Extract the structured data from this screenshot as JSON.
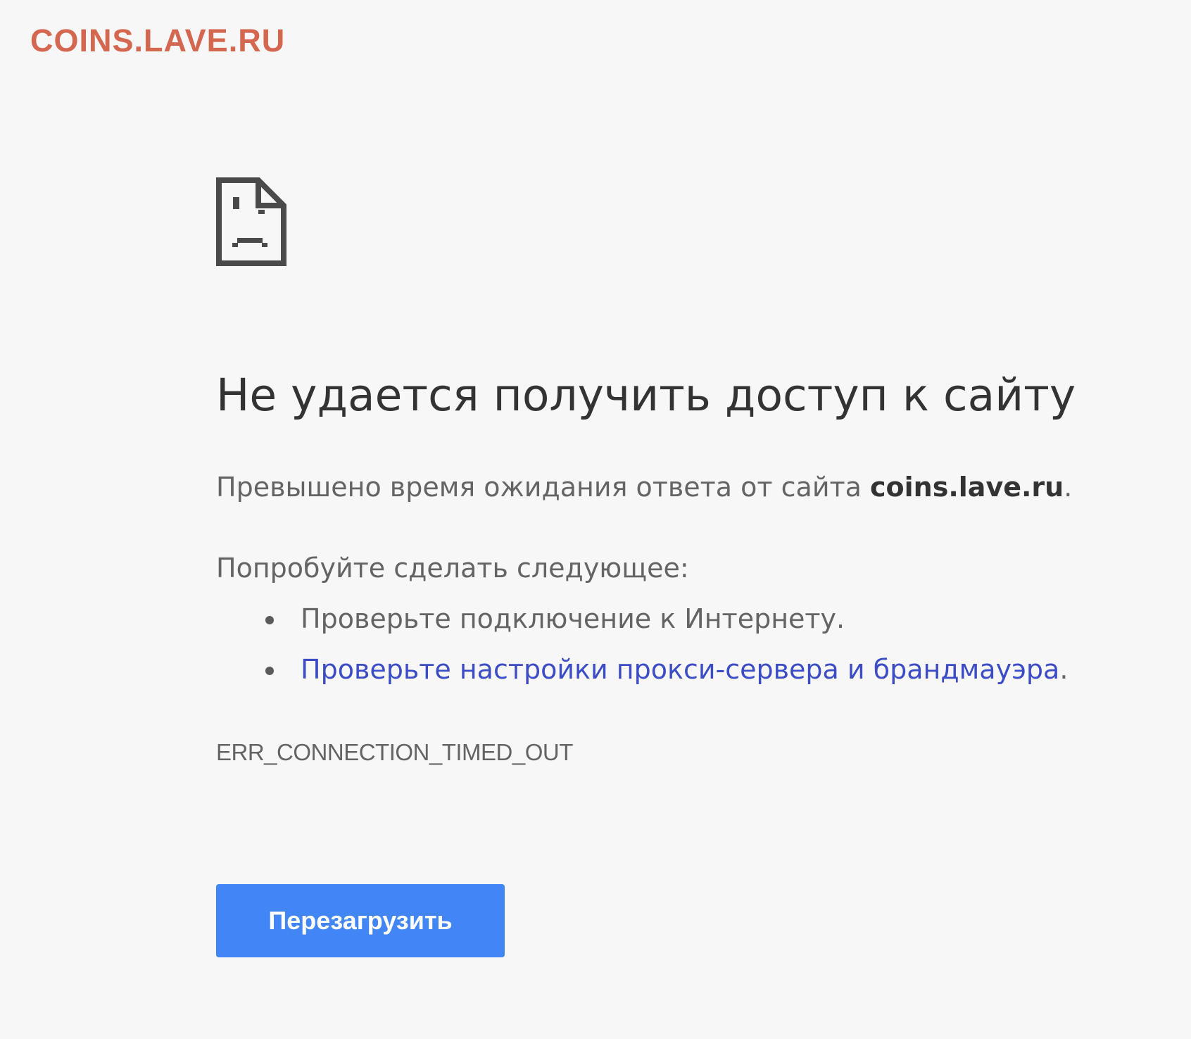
{
  "watermark": {
    "text": "COINS.LAVE.RU"
  },
  "error_page": {
    "icon": "sad-document-icon",
    "heading": "Не удается получить доступ к сайту",
    "summary_prefix": "Превышено время ожидания ответа от сайта ",
    "summary_host": "coins.lave.ru",
    "summary_suffix": ".",
    "suggestions_title": "Попробуйте сделать следующее:",
    "suggestions": [
      {
        "text": "Проверьте подключение к Интернету.",
        "link": false
      },
      {
        "link_text": "Проверьте настройки прокси-сервера и брандмауэра",
        "suffix": ".",
        "link": true
      }
    ],
    "error_code": "ERR_CONNECTION_TIMED_OUT",
    "reload_label": "Перезагрузить"
  },
  "colors": {
    "background": "#f7f7f7",
    "watermark": "#d4674f",
    "heading": "#333333",
    "body_text": "#646464",
    "link": "#3b4cc4",
    "button": "#4285f4",
    "button_text": "#ffffff"
  }
}
